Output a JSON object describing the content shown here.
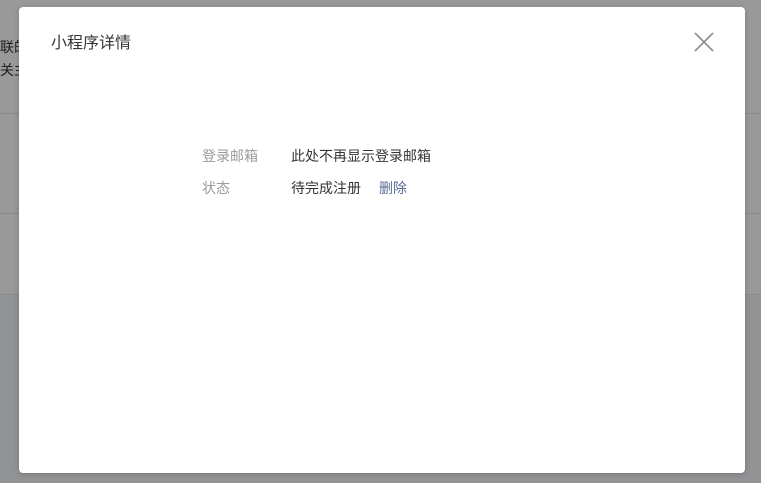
{
  "background": {
    "line1": "联的",
    "line2": "关主"
  },
  "dialog": {
    "title": "小程序详情",
    "close_icon": "close-icon",
    "fields": [
      {
        "label": "登录邮箱",
        "value": "此处不再显示登录邮箱"
      },
      {
        "label": "状态",
        "value": "待完成注册",
        "action": "删除"
      }
    ]
  },
  "colors": {
    "link": "#576b95",
    "label": "#9a9a9a",
    "text": "#353535",
    "overlay": "rgba(0,0,0,0.4)"
  }
}
